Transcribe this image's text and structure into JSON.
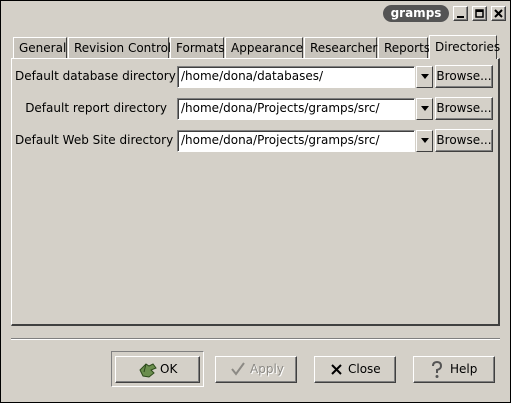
{
  "window": {
    "title": "gramps",
    "controls": [
      "minimize-icon",
      "maximize-icon",
      "close-icon"
    ]
  },
  "tabs": [
    {
      "label": "General",
      "active": false
    },
    {
      "label": "Revision Control",
      "active": false
    },
    {
      "label": "Formats",
      "active": false
    },
    {
      "label": "Appearance",
      "active": false
    },
    {
      "label": "Researcher",
      "active": false
    },
    {
      "label": "Reports",
      "active": false
    },
    {
      "label": "Directories",
      "active": true
    }
  ],
  "rows": [
    {
      "label": "Default database directory",
      "value": "/home/dona/databases/",
      "browse": "Browse..."
    },
    {
      "label": "Default report directory",
      "value": "/home/dona/Projects/gramps/src/",
      "browse": "Browse..."
    },
    {
      "label": "Default Web Site directory",
      "value": "/home/dona/Projects/gramps/src/",
      "browse": "Browse..."
    }
  ],
  "buttons": {
    "ok": "OK",
    "apply": "Apply",
    "close": "Close",
    "help": "Help"
  }
}
